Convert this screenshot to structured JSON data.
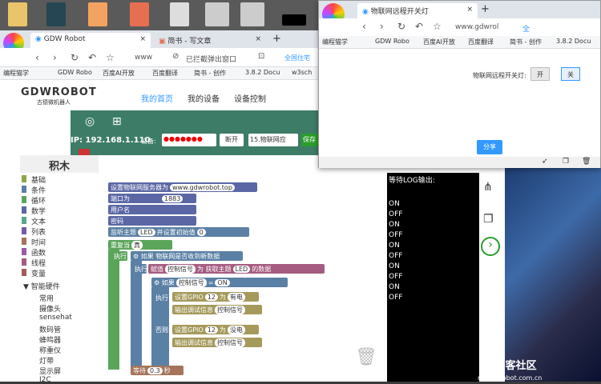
{
  "main_browser": {
    "tabs": [
      {
        "label": "GDW Robot"
      },
      {
        "label": "简书 - 写文章"
      }
    ],
    "address": "www",
    "popup_blocked": "已拦截弹出窗口",
    "search_hint": "全国住宅"
  },
  "bookmarks": [
    "编程猫学",
    "GDW Robo",
    "百度AI开放",
    "百度翻译",
    "简书 - 创作",
    "3.8.2 Docu",
    "w3sch"
  ],
  "site": {
    "logo": "GDWROBOT",
    "logo_sub": "古德微机器人",
    "nav": [
      "我的首页",
      "我的设备",
      "设备控制"
    ]
  },
  "toolbar": {
    "ip_label": "IP: 192.168.1.110",
    "device_label": "设备:",
    "device_value": "●●●●●●●",
    "disconnect": "断开",
    "mode": "15.物联网应",
    "save": "保存"
  },
  "palette": {
    "title": "积木",
    "categories": [
      {
        "label": "基础",
        "color": "#8aa64a"
      },
      {
        "label": "条件",
        "color": "#5b80a5"
      },
      {
        "label": "循环",
        "color": "#5ba55b"
      },
      {
        "label": "数学",
        "color": "#5b67a5"
      },
      {
        "label": "文本",
        "color": "#5ba58c"
      },
      {
        "label": "列表",
        "color": "#745ba5"
      },
      {
        "label": "时间",
        "color": "#a5745b"
      },
      {
        "label": "函数",
        "color": "#9a5ba5"
      },
      {
        "label": "线程",
        "color": "#a55b80"
      },
      {
        "label": "变量",
        "color": "#a55b5b"
      }
    ],
    "group": "▼ 智能硬件",
    "sub": [
      "常用",
      "摄像头",
      "sensehat",
      "数码管",
      "蜂鸣器",
      "称重仪",
      "灯带",
      "显示屏",
      "I2C"
    ]
  },
  "blocks": {
    "server_label": "设置物联网服务器为",
    "server": "www.gdwrobot.top",
    "port_label": "端口为",
    "port": "1883",
    "user_label": "用户名",
    "pass_label": "密码",
    "listen_label": "监听主题",
    "topic": "LED",
    "init_label": "并设置初始值",
    "init": "0",
    "repeat_label": "重复当",
    "true": "真",
    "exec": "执行",
    "if_label": "如果",
    "if_cond": "物联网是否收到新数据",
    "assign": "赋值",
    "var": "控制信号",
    "to": "为",
    "get_topic": "获取主题",
    "data": "的数据",
    "eq": "=",
    "on": "ON",
    "set_gpio": "设置GPIO",
    "gpio": "12",
    "high": "有电",
    "low": "没电",
    "debug": "输出调试信息",
    "else": "否则",
    "wait": "等待",
    "wait_val": "0.3",
    "sec": "秒"
  },
  "log": {
    "title": "等待LOG输出:",
    "lines": [
      "ON",
      "OFF",
      "ON",
      "OFF",
      "ON",
      "OFF",
      "ON",
      "OFF",
      "ON",
      "OFF"
    ]
  },
  "popup": {
    "tab": "物联网远程开关灯",
    "address": "www.gdwrol",
    "search": "全",
    "bookmarks": [
      "编程猫学",
      "GDW Robo",
      "百度AI开放",
      "百度翻译",
      "简书 - 创作",
      "3.8.2 Docu"
    ],
    "label": "物联网远程开关灯:",
    "on": "开",
    "off": "关",
    "share": "分享"
  },
  "watermark": {
    "brand": "DF创客社区",
    "url": "mc.DFRobot.com.cn"
  }
}
